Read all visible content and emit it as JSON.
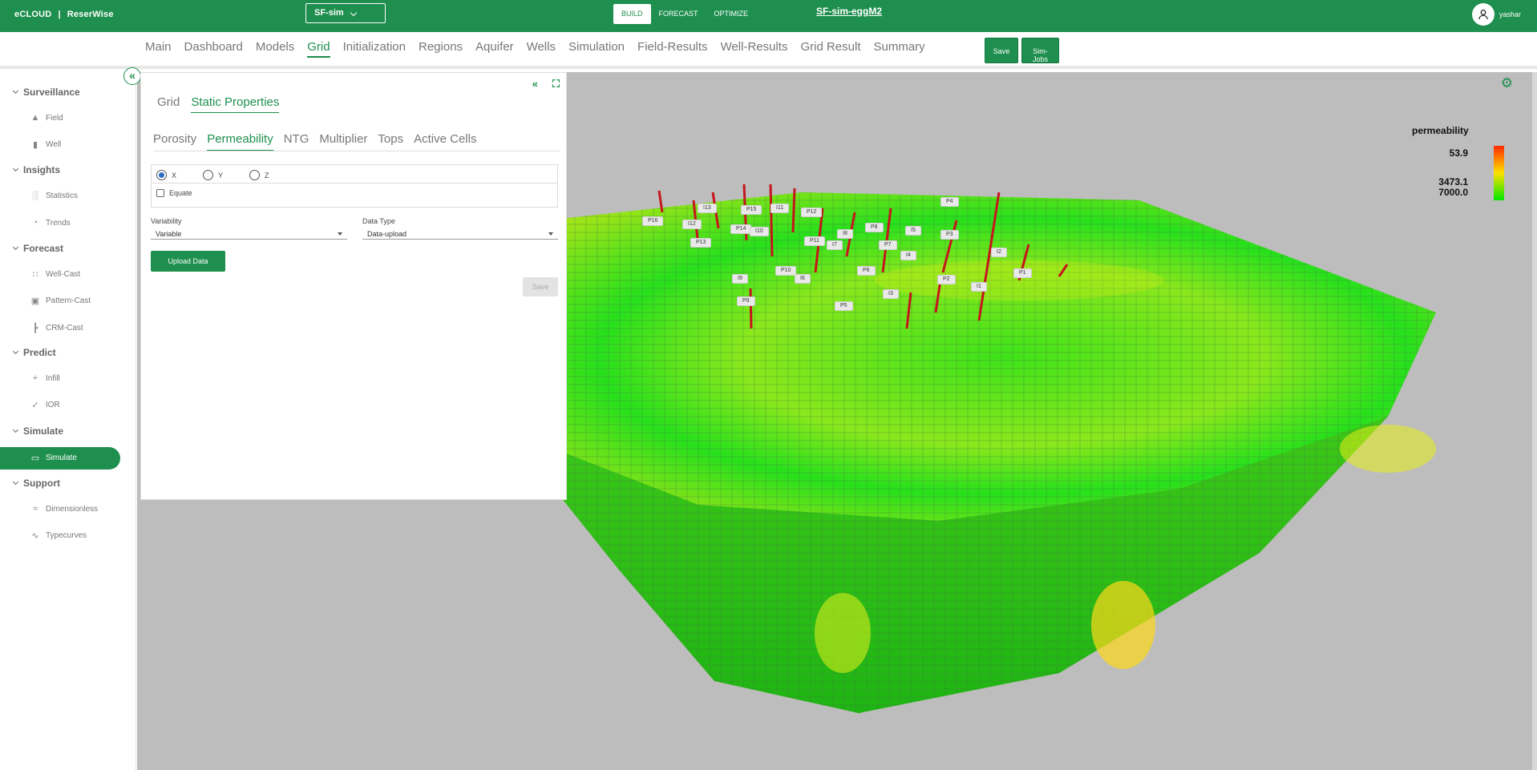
{
  "app": {
    "brand": "eCLOUD",
    "product": "ReserWise",
    "separator": "|"
  },
  "project_select": {
    "value": "SF-sim"
  },
  "mode_tabs": [
    {
      "label": "BUILD",
      "active": true
    },
    {
      "label": "FORECAST",
      "active": false
    },
    {
      "label": "OPTIMIZE",
      "active": false
    }
  ],
  "simulation_name": "SF-sim-eggM2",
  "user": {
    "name": "yashar"
  },
  "nav": {
    "items": [
      "Main",
      "Dashboard",
      "Models",
      "Grid",
      "Initialization",
      "Regions",
      "Aquifer",
      "Wells",
      "Simulation",
      "Field-Results",
      "Well-Results",
      "Grid Result",
      "Summary"
    ],
    "active": "Grid",
    "save_label": "Save",
    "simjobs_label": "Sim-Jobs"
  },
  "sidebar": {
    "groups": [
      {
        "label": "Surveillance",
        "items": [
          {
            "label": "Field",
            "icon": "area-chart-icon"
          },
          {
            "label": "Well",
            "icon": "well-icon"
          }
        ]
      },
      {
        "label": "Insights",
        "items": [
          {
            "label": "Statistics",
            "icon": "bar-chart-icon"
          },
          {
            "label": "Trends",
            "icon": "trend-icon"
          }
        ]
      },
      {
        "label": "Forecast",
        "items": [
          {
            "label": "Well-Cast",
            "icon": "dots-icon"
          },
          {
            "label": "Pattern-Cast",
            "icon": "pattern-icon"
          },
          {
            "label": "CRM-Cast",
            "icon": "tree-icon"
          }
        ]
      },
      {
        "label": "Predict",
        "items": [
          {
            "label": "Infill",
            "icon": "plus-icon"
          },
          {
            "label": "IOR",
            "icon": "gear-check-icon"
          }
        ]
      },
      {
        "label": "Simulate",
        "items": [
          {
            "label": "Simulate",
            "icon": "laptop-icon",
            "active": true
          }
        ]
      },
      {
        "label": "Support",
        "items": [
          {
            "label": "Dimensionless",
            "icon": "curve-icon"
          },
          {
            "label": "Typecurves",
            "icon": "typecurve-icon"
          }
        ]
      }
    ]
  },
  "panel": {
    "tabs": [
      "Grid",
      "Static Properties"
    ],
    "active_tab": "Static Properties",
    "sub_tabs": [
      "Porosity",
      "Permeability",
      "NTG",
      "Multiplier",
      "Tops",
      "Active Cells"
    ],
    "active_sub_tab": "Permeability",
    "axes": [
      {
        "label": "X",
        "checked": true
      },
      {
        "label": "Y",
        "checked": false
      },
      {
        "label": "Z",
        "checked": false
      }
    ],
    "equate_label": "Equate",
    "variability": {
      "label": "Variability",
      "value": "Variable"
    },
    "data_type": {
      "label": "Data Type",
      "value": "Data-upload"
    },
    "upload_label": "Upload Data",
    "save_label": "Save"
  },
  "legend": {
    "title": "permeability",
    "values": [
      "53.9",
      "3473.1",
      "7000.0"
    ],
    "colors": {
      "high": "#ff2a00",
      "mid": "#ffe100",
      "low": "#00e800"
    }
  },
  "wells": [
    "P16",
    "I12",
    "I13",
    "P15",
    "I11",
    "P12",
    "P14",
    "I10",
    "P13",
    "P11",
    "I8",
    "P8",
    "I5",
    "I7",
    "P7",
    "I4",
    "P4",
    "P3",
    "I2",
    "P1",
    "P10",
    "I6",
    "P6",
    "I9",
    "P2",
    "I1",
    "P9",
    "P5",
    "I3"
  ],
  "colors": {
    "brand_green": "#1e8f4e",
    "viewer_bg": "#bdbdbd"
  }
}
